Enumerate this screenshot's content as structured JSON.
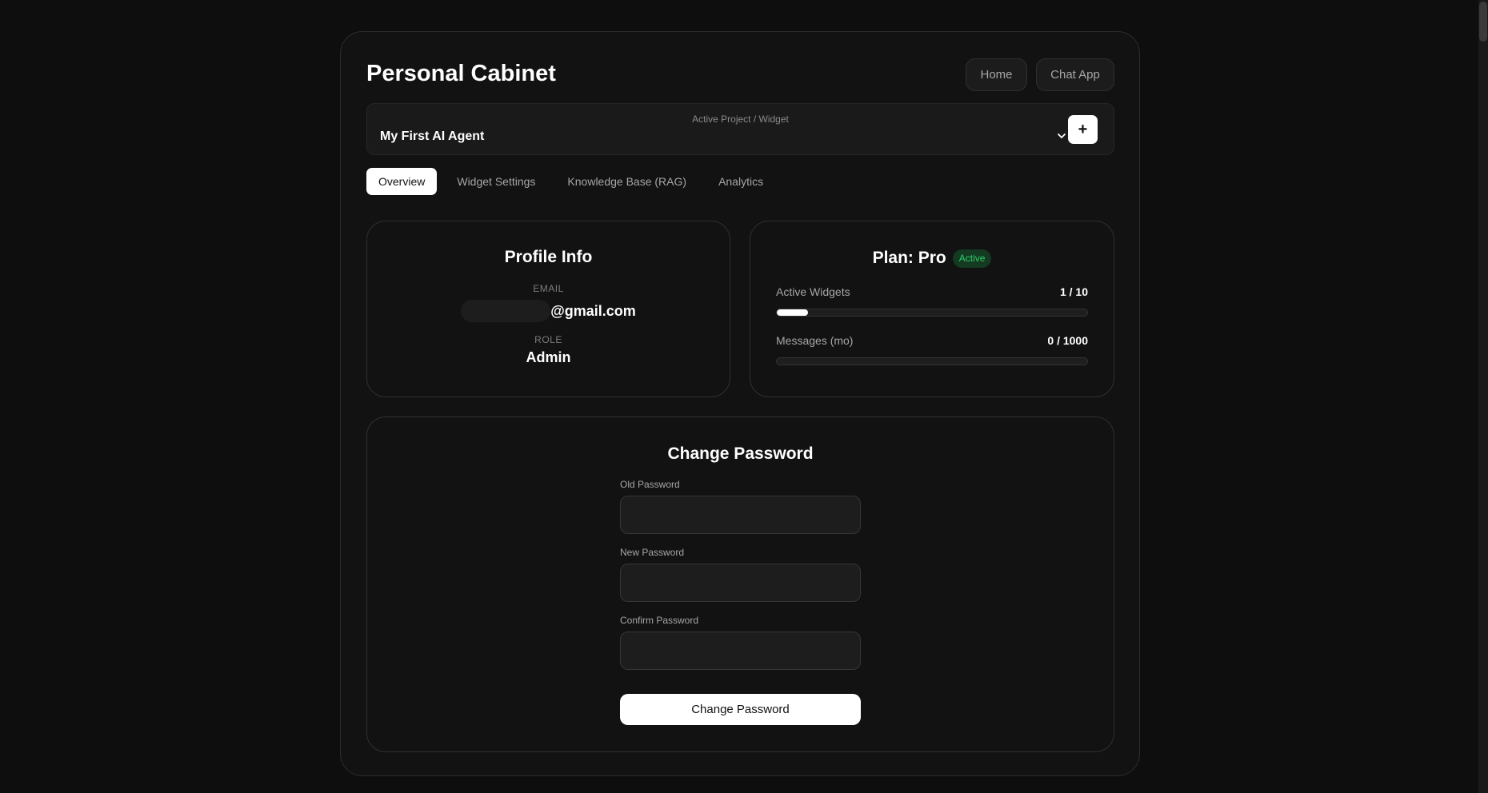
{
  "header": {
    "title": "Personal Cabinet",
    "nav": {
      "home_label": "Home",
      "chat_label": "Chat App"
    }
  },
  "project": {
    "caption": "Active Project / Widget",
    "selected": "My First AI Agent",
    "add_label": "+"
  },
  "tabs": [
    {
      "label": "Overview",
      "active": true
    },
    {
      "label": "Widget Settings",
      "active": false
    },
    {
      "label": "Knowledge Base (RAG)",
      "active": false
    },
    {
      "label": "Analytics",
      "active": false
    }
  ],
  "profile": {
    "title": "Profile Info",
    "email_caption": "EMAIL",
    "email_visible": "@gmail.com",
    "role_caption": "ROLE",
    "role": "Admin"
  },
  "plan": {
    "title": "Plan: Pro",
    "status": "Active",
    "status_color": "#2fce6a",
    "usage": [
      {
        "label": "Active Widgets",
        "value_text": "1 / 10",
        "fraction": 0.1
      },
      {
        "label": "Messages (mo)",
        "value_text": "0 / 1000",
        "fraction": 0
      }
    ]
  },
  "password": {
    "title": "Change Password",
    "old_label": "Old Password",
    "old_value": "",
    "new_label": "New Password",
    "new_value": "",
    "confirm_label": "Confirm Password",
    "confirm_value": "",
    "submit_label": "Change Password"
  },
  "icons": {
    "select": "chevron-down-icon",
    "add": "plus-icon"
  },
  "colors": {
    "background": "#0e0e0e",
    "panel": "#121212",
    "accent": "#ffffff"
  }
}
